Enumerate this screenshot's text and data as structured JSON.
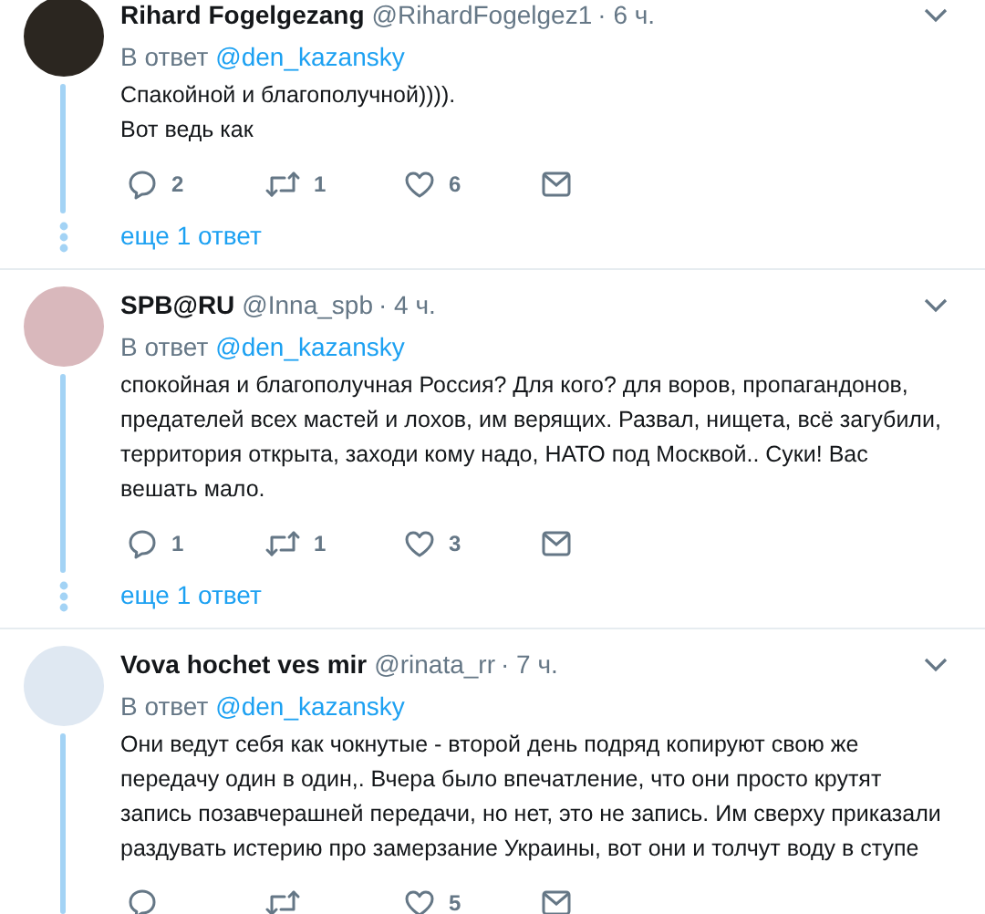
{
  "tweets": [
    {
      "name": "Rihard Fogelgezang",
      "handle": "@RihardFogelgez1",
      "time": "· 6 ч.",
      "reply_label": "В ответ",
      "reply_to": "@den_kazansky",
      "lines": [
        "Спакойной и благополучной)))).",
        "Вот ведь как"
      ],
      "replies": "2",
      "retweets": "1",
      "likes": "6",
      "more": "еще 1 ответ"
    },
    {
      "name": "SPB@RU",
      "handle": "@Inna_spb",
      "time": "· 4 ч.",
      "reply_label": "В ответ",
      "reply_to": "@den_kazansky",
      "lines": [
        "спокойная и благополучная Россия? Для кого? для воров, пропагандонов,",
        "предателей всех мастей и лохов, им верящих. Развал, нищета, всё загубили,",
        "территория открыта, заходи кому надо, НАТО под Москвой.. Суки! Вас",
        "вешать мало."
      ],
      "replies": "1",
      "retweets": "1",
      "likes": "3",
      "more": "еще 1 ответ"
    },
    {
      "name": "Vova hochet ves mir",
      "handle": "@rinata_rr",
      "time": "· 7 ч.",
      "reply_label": "В ответ",
      "reply_to": "@den_kazansky",
      "lines": [
        "Они ведут себя как чокнутые - второй день подряд копируют свою же",
        "передачу один в один,. Вчера было впечатление, что они просто крутят",
        "запись позавчерашней передачи, но нет, это не запись. Им сверху приказали",
        "раздувать истерию про замерзание Украины, вот они и толчут воду в ступе"
      ],
      "likes": "5"
    }
  ]
}
